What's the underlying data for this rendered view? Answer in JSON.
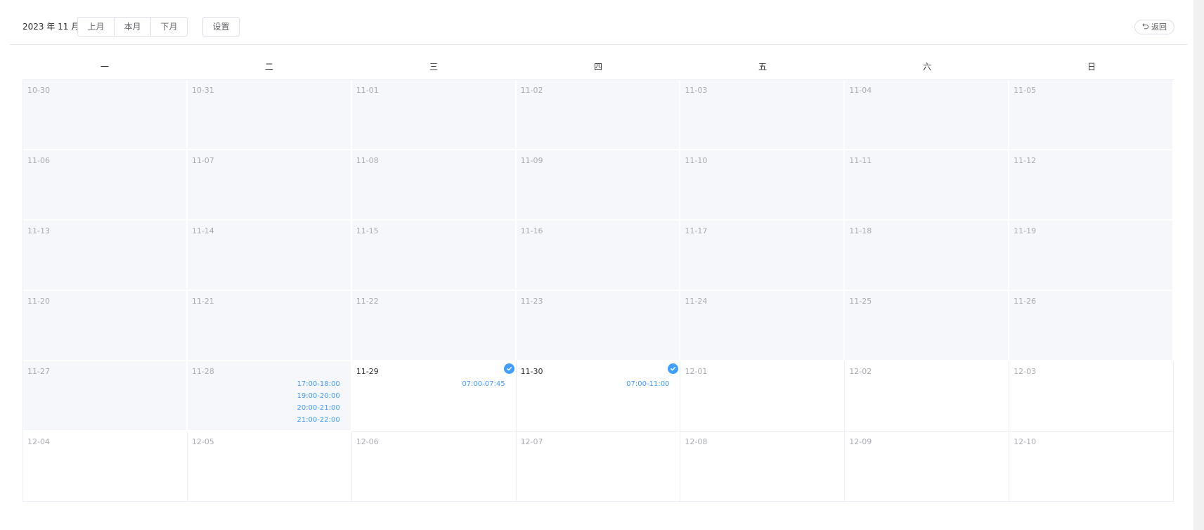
{
  "header": {
    "month_label": "2023 年 11 月",
    "prev_month": "上月",
    "this_month": "本月",
    "next_month": "下月",
    "settings": "设置",
    "back": "返回"
  },
  "weekdays": [
    "一",
    "二",
    "三",
    "四",
    "五",
    "六",
    "日"
  ],
  "colors": {
    "accent": "#409eff",
    "past_bg": "#f5f7fa",
    "muted_text": "#a8abb2"
  },
  "days": [
    {
      "date": "10-30",
      "state": "past"
    },
    {
      "date": "10-31",
      "state": "past"
    },
    {
      "date": "11-01",
      "state": "past"
    },
    {
      "date": "11-02",
      "state": "past"
    },
    {
      "date": "11-03",
      "state": "past"
    },
    {
      "date": "11-04",
      "state": "past"
    },
    {
      "date": "11-05",
      "state": "past"
    },
    {
      "date": "11-06",
      "state": "past"
    },
    {
      "date": "11-07",
      "state": "past"
    },
    {
      "date": "11-08",
      "state": "past"
    },
    {
      "date": "11-09",
      "state": "past"
    },
    {
      "date": "11-10",
      "state": "past"
    },
    {
      "date": "11-11",
      "state": "past"
    },
    {
      "date": "11-12",
      "state": "past"
    },
    {
      "date": "11-13",
      "state": "past"
    },
    {
      "date": "11-14",
      "state": "past"
    },
    {
      "date": "11-15",
      "state": "past"
    },
    {
      "date": "11-16",
      "state": "past"
    },
    {
      "date": "11-17",
      "state": "past"
    },
    {
      "date": "11-18",
      "state": "past"
    },
    {
      "date": "11-19",
      "state": "past"
    },
    {
      "date": "11-20",
      "state": "past"
    },
    {
      "date": "11-21",
      "state": "past"
    },
    {
      "date": "11-22",
      "state": "past"
    },
    {
      "date": "11-23",
      "state": "past"
    },
    {
      "date": "11-24",
      "state": "past"
    },
    {
      "date": "11-25",
      "state": "past"
    },
    {
      "date": "11-26",
      "state": "past"
    },
    {
      "date": "11-27",
      "state": "past"
    },
    {
      "date": "11-28",
      "state": "past",
      "slots": [
        "17:00-18:00",
        "19:00-20:00",
        "20:00-21:00",
        "21:00-22:00"
      ]
    },
    {
      "date": "11-29",
      "state": "current",
      "checked": true,
      "slots": [
        "07:00-07:45"
      ]
    },
    {
      "date": "11-30",
      "state": "current",
      "checked": true,
      "slots": [
        "07:00-11:00"
      ]
    },
    {
      "date": "12-01",
      "state": "next"
    },
    {
      "date": "12-02",
      "state": "next"
    },
    {
      "date": "12-03",
      "state": "next"
    },
    {
      "date": "12-04",
      "state": "next"
    },
    {
      "date": "12-05",
      "state": "next"
    },
    {
      "date": "12-06",
      "state": "next"
    },
    {
      "date": "12-07",
      "state": "next"
    },
    {
      "date": "12-08",
      "state": "next"
    },
    {
      "date": "12-09",
      "state": "next"
    },
    {
      "date": "12-10",
      "state": "next"
    }
  ]
}
